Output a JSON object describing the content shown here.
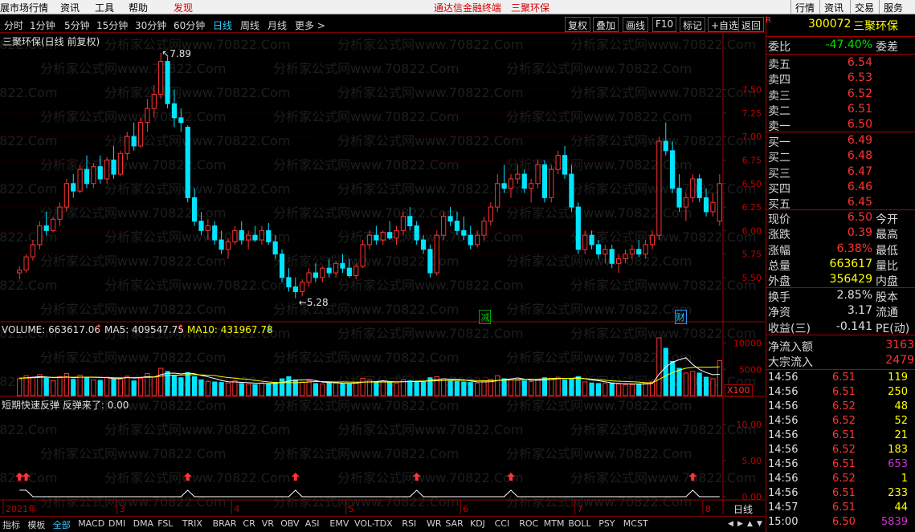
{
  "topbar": {
    "items": [
      "展市场行情",
      "资讯",
      "工具",
      "帮助"
    ],
    "highlight": "发现",
    "center_items": [
      "通达信金融终端",
      "三聚环保"
    ],
    "right_buttons": [
      "行情",
      "资讯",
      "交易",
      "服务"
    ]
  },
  "toolbar": {
    "periods": [
      "分时",
      "1分钟",
      "5分钟",
      "15分钟",
      "30分钟",
      "60分钟",
      "日线",
      "周线",
      "月线",
      "更多 >"
    ],
    "active_period": "日线",
    "buttons": [
      "复权",
      "叠加",
      "画线",
      "F10",
      "标记",
      "+自选",
      "返回"
    ]
  },
  "chart": {
    "title": "三聚环保(日线 前复权)",
    "high_label": "7.89",
    "low_label": "5.28",
    "price_axis": [
      "7.50",
      "7.25",
      "7.00",
      "6.75",
      "6.50",
      "6.25",
      "6.00",
      "5.75",
      "5.50"
    ],
    "badge_jian": "减",
    "badge_cai": "财",
    "volume_label": "VOLUME: 663617.06",
    "ma5_label": "MA5: 409547.75",
    "ma10_label": "MA10: 431967.78",
    "vol_axis": [
      "10000",
      "5000"
    ],
    "vol_unit": "X100",
    "indicator_label": "短期快速反弹 反弹来了: 0.00",
    "ind_axis": [
      "10.00",
      "5.00",
      "0.00"
    ],
    "date_labels": [
      "2021年",
      "3",
      "4",
      "5",
      "6",
      "7",
      "8"
    ],
    "period_name": "日线",
    "watermark": "分析家公式网www.70822.Com"
  },
  "panel": {
    "code": "300072",
    "name": "三聚环保",
    "weibi_label": "委比",
    "weibi_value": "-47.40%",
    "weicha_label": "委差",
    "asks": [
      {
        "label": "卖五",
        "price": "6.54"
      },
      {
        "label": "卖四",
        "price": "6.53"
      },
      {
        "label": "卖三",
        "price": "6.52"
      },
      {
        "label": "卖二",
        "price": "6.51"
      },
      {
        "label": "卖一",
        "price": "6.50"
      }
    ],
    "bids": [
      {
        "label": "买一",
        "price": "6.49"
      },
      {
        "label": "买二",
        "price": "6.48"
      },
      {
        "label": "买三",
        "price": "6.47"
      },
      {
        "label": "买四",
        "price": "6.46"
      },
      {
        "label": "买五",
        "price": "6.45"
      }
    ],
    "stats": [
      {
        "l": "现价",
        "v": "6.50",
        "r": "今开"
      },
      {
        "l": "涨跌",
        "v": "0.39",
        "r": "最高"
      },
      {
        "l": "涨幅",
        "v": "6.38%",
        "r": "最低"
      },
      {
        "l": "总量",
        "v": "663617",
        "r": "量比"
      },
      {
        "l": "外盘",
        "v": "356429",
        "r": "内盘"
      }
    ],
    "stats2": [
      {
        "l": "换手",
        "v": "2.85%",
        "r": "股本"
      },
      {
        "l": "净资",
        "v": "3.17",
        "r": "流通"
      },
      {
        "l": "收益(三)",
        "v": "-0.141",
        "r": "PE(动)"
      }
    ],
    "flow": [
      {
        "l": "净流入额",
        "v": "3163"
      },
      {
        "l": "大宗流入",
        "v": "2479"
      }
    ],
    "ticks": [
      {
        "t": "14:56",
        "p": "6.51",
        "v": "119",
        "c": "#ffff00"
      },
      {
        "t": "14:56",
        "p": "6.51",
        "v": "250",
        "c": "#ffff00"
      },
      {
        "t": "14:56",
        "p": "6.52",
        "v": "48",
        "c": "#ffff00"
      },
      {
        "t": "14:56",
        "p": "6.52",
        "v": "52",
        "c": "#ffff00"
      },
      {
        "t": "14:56",
        "p": "6.51",
        "v": "21",
        "c": "#ffff00"
      },
      {
        "t": "14:56",
        "p": "6.52",
        "v": "183",
        "c": "#ffff00"
      },
      {
        "t": "14:56",
        "p": "6.51",
        "v": "653",
        "c": "#cc33cc"
      },
      {
        "t": "14:56",
        "p": "6.52",
        "v": "1",
        "c": "#ffff00"
      },
      {
        "t": "14:56",
        "p": "6.51",
        "v": "233",
        "c": "#ffff00"
      },
      {
        "t": "14:57",
        "p": "6.51",
        "v": "44",
        "c": "#ffff00"
      },
      {
        "t": "15:00",
        "p": "6.50",
        "v": "5839",
        "c": "#cc33cc"
      }
    ]
  },
  "bottom_tabs": [
    "指标",
    "模板",
    "全部",
    "MACD",
    "DMI",
    "DMA",
    "FSL",
    "TRIX",
    "BRAR",
    "CR",
    "VR",
    "OBV",
    "ASI",
    "EMV",
    "VOL-TDX",
    "RSI",
    "WR",
    "SAR",
    "KDJ",
    "CCI",
    "ROC",
    "MTM",
    "BOLL",
    "PSY",
    "MCST"
  ],
  "active_tab": "全部",
  "chart_data": {
    "type": "candlestick",
    "price_ylim": [
      5.2,
      7.95
    ],
    "candles": [
      [
        5.55,
        5.62,
        5.48,
        5.58
      ],
      [
        5.58,
        5.75,
        5.55,
        5.72
      ],
      [
        5.72,
        5.9,
        5.68,
        5.85
      ],
      [
        5.85,
        6.1,
        5.8,
        6.05
      ],
      [
        6.05,
        6.2,
        5.95,
        6.0
      ],
      [
        6.0,
        6.15,
        5.98,
        6.12
      ],
      [
        6.12,
        6.3,
        6.05,
        6.25
      ],
      [
        6.25,
        6.55,
        6.2,
        6.5
      ],
      [
        6.5,
        6.6,
        6.35,
        6.42
      ],
      [
        6.42,
        6.7,
        6.4,
        6.65
      ],
      [
        6.65,
        6.8,
        6.45,
        6.5
      ],
      [
        6.5,
        6.72,
        6.45,
        6.68
      ],
      [
        6.68,
        6.8,
        6.5,
        6.55
      ],
      [
        6.55,
        6.78,
        6.5,
        6.75
      ],
      [
        6.75,
        6.9,
        6.55,
        6.6
      ],
      [
        6.6,
        6.85,
        6.58,
        6.82
      ],
      [
        6.82,
        7.05,
        6.75,
        7.0
      ],
      [
        7.0,
        7.15,
        6.85,
        6.9
      ],
      [
        6.9,
        7.2,
        6.88,
        7.15
      ],
      [
        7.15,
        7.4,
        7.05,
        7.3
      ],
      [
        7.3,
        7.55,
        7.2,
        7.45
      ],
      [
        7.45,
        7.89,
        7.4,
        7.8
      ],
      [
        7.8,
        7.85,
        7.3,
        7.35
      ],
      [
        7.35,
        7.5,
        7.1,
        7.2
      ],
      [
        7.2,
        7.3,
        7.05,
        7.15
      ],
      [
        7.1,
        7.12,
        6.3,
        6.35
      ],
      [
        6.35,
        6.45,
        6.05,
        6.1
      ],
      [
        6.1,
        6.2,
        5.95,
        6.0
      ],
      [
        6.0,
        6.12,
        5.9,
        6.05
      ],
      [
        6.05,
        6.1,
        5.85,
        5.9
      ],
      [
        5.9,
        6.0,
        5.75,
        5.8
      ],
      [
        5.8,
        5.92,
        5.7,
        5.88
      ],
      [
        5.88,
        6.05,
        5.85,
        6.0
      ],
      [
        6.0,
        6.1,
        5.85,
        5.9
      ],
      [
        5.9,
        6.0,
        5.8,
        5.95
      ],
      [
        5.95,
        6.05,
        5.88,
        5.9
      ],
      [
        5.9,
        6.05,
        5.85,
        6.0
      ],
      [
        6.0,
        6.08,
        5.85,
        5.88
      ],
      [
        5.88,
        5.95,
        5.7,
        5.75
      ],
      [
        5.75,
        5.8,
        5.45,
        5.5
      ],
      [
        5.5,
        5.6,
        5.35,
        5.4
      ],
      [
        5.4,
        5.5,
        5.28,
        5.35
      ],
      [
        5.35,
        5.48,
        5.3,
        5.45
      ],
      [
        5.45,
        5.6,
        5.4,
        5.55
      ],
      [
        5.55,
        5.65,
        5.45,
        5.5
      ],
      [
        5.5,
        5.62,
        5.45,
        5.6
      ],
      [
        5.6,
        5.7,
        5.5,
        5.55
      ],
      [
        5.55,
        5.68,
        5.5,
        5.65
      ],
      [
        5.65,
        5.75,
        5.55,
        5.6
      ],
      [
        5.6,
        5.7,
        5.5,
        5.52
      ],
      [
        5.52,
        5.65,
        5.48,
        5.62
      ],
      [
        5.62,
        5.9,
        5.6,
        5.85
      ],
      [
        5.85,
        6.0,
        5.8,
        5.95
      ],
      [
        5.95,
        6.05,
        5.85,
        5.9
      ],
      [
        5.9,
        6.0,
        5.85,
        5.98
      ],
      [
        5.98,
        6.1,
        5.9,
        5.92
      ],
      [
        5.92,
        6.05,
        5.85,
        6.0
      ],
      [
        6.0,
        6.2,
        5.95,
        6.15
      ],
      [
        6.15,
        6.25,
        6.0,
        6.05
      ],
      [
        6.05,
        6.1,
        5.85,
        5.9
      ],
      [
        5.9,
        5.95,
        5.75,
        5.8
      ],
      [
        5.8,
        5.85,
        5.5,
        5.55
      ],
      [
        5.55,
        6.0,
        5.52,
        5.95
      ],
      [
        5.95,
        6.2,
        5.9,
        6.15
      ],
      [
        6.15,
        6.25,
        6.05,
        6.1
      ],
      [
        6.1,
        6.2,
        5.95,
        6.0
      ],
      [
        6.0,
        6.15,
        5.9,
        5.95
      ],
      [
        5.95,
        6.05,
        5.8,
        5.85
      ],
      [
        5.85,
        6.0,
        5.82,
        5.95
      ],
      [
        5.95,
        6.15,
        5.9,
        6.1
      ],
      [
        6.1,
        6.3,
        6.05,
        6.25
      ],
      [
        6.25,
        6.6,
        6.2,
        6.5
      ],
      [
        6.5,
        6.7,
        6.4,
        6.45
      ],
      [
        6.45,
        6.6,
        6.35,
        6.55
      ],
      [
        6.55,
        6.7,
        6.5,
        6.6
      ],
      [
        6.6,
        6.65,
        6.4,
        6.45
      ],
      [
        6.45,
        6.55,
        6.3,
        6.5
      ],
      [
        6.5,
        6.75,
        6.45,
        6.7
      ],
      [
        6.7,
        6.75,
        6.3,
        6.35
      ],
      [
        6.35,
        6.7,
        6.3,
        6.65
      ],
      [
        6.65,
        6.85,
        6.6,
        6.8
      ],
      [
        6.8,
        6.9,
        6.55,
        6.6
      ],
      [
        6.6,
        6.7,
        6.2,
        6.25
      ],
      [
        6.25,
        6.3,
        5.75,
        5.8
      ],
      [
        5.8,
        6.0,
        5.75,
        5.95
      ],
      [
        5.95,
        6.0,
        5.8,
        5.85
      ],
      [
        5.85,
        5.9,
        5.7,
        5.75
      ],
      [
        5.75,
        5.85,
        5.65,
        5.8
      ],
      [
        5.8,
        5.85,
        5.6,
        5.65
      ],
      [
        5.65,
        5.75,
        5.55,
        5.7
      ],
      [
        5.7,
        5.8,
        5.65,
        5.75
      ],
      [
        5.75,
        5.85,
        5.7,
        5.8
      ],
      [
        5.8,
        5.9,
        5.72,
        5.75
      ],
      [
        5.75,
        5.9,
        5.7,
        5.85
      ],
      [
        5.85,
        6.0,
        5.8,
        5.95
      ],
      [
        5.95,
        7.0,
        5.9,
        6.95
      ],
      [
        6.95,
        7.15,
        6.8,
        6.85
      ],
      [
        6.85,
        6.95,
        6.4,
        6.45
      ],
      [
        6.45,
        6.6,
        6.2,
        6.25
      ],
      [
        6.25,
        6.4,
        6.1,
        6.35
      ],
      [
        6.35,
        6.6,
        6.3,
        6.55
      ],
      [
        6.55,
        6.6,
        6.3,
        6.35
      ],
      [
        6.35,
        6.45,
        6.15,
        6.2
      ],
      [
        6.2,
        6.4,
        6.15,
        6.3
      ],
      [
        6.1,
        6.6,
        6.05,
        6.5
      ]
    ],
    "volumes": [
      3200,
      3800,
      3500,
      4000,
      3300,
      2800,
      3600,
      4200,
      3100,
      3900,
      3400,
      3000,
      2900,
      3500,
      3200,
      3100,
      3700,
      2800,
      3300,
      4200,
      3600,
      5200,
      4600,
      3800,
      3400,
      4400,
      3600,
      3000,
      2700,
      2600,
      2500,
      2400,
      2800,
      2300,
      2200,
      2100,
      2400,
      2300,
      2500,
      3200,
      3600,
      3000,
      2600,
      2800,
      2300,
      2200,
      2500,
      2400,
      2300,
      2200,
      2400,
      3300,
      2900,
      2600,
      2700,
      2500,
      2400,
      3000,
      2800,
      2700,
      2600,
      3400,
      3600,
      3200,
      2900,
      2700,
      2600,
      2500,
      2400,
      2800,
      3100,
      3800,
      3200,
      3000,
      2900,
      2800,
      2700,
      3100,
      3400,
      3300,
      3500,
      3000,
      3300,
      3600,
      2600,
      2400,
      2300,
      2300,
      2400,
      2200,
      2100,
      2100,
      2200,
      2400,
      2600,
      11000,
      9000,
      6500,
      5200,
      4300,
      4600,
      4300,
      3500,
      3200,
      6638
    ],
    "ma5": [
      3300,
      3400,
      3500,
      3600,
      3560,
      3440,
      3440,
      3580,
      3400,
      3520,
      3520,
      3520,
      3480,
      3420,
      3200,
      3240,
      3480,
      3340,
      3440,
      3620,
      3520,
      4000,
      4240,
      4280,
      4120,
      4280,
      4160,
      3840,
      3580,
      3240,
      2880,
      2640,
      2600,
      2520,
      2460,
      2360,
      2360,
      2300,
      2340,
      2500,
      2740,
      2920,
      2980,
      3040,
      2860,
      2580,
      2480,
      2440,
      2340,
      2320,
      2360,
      2560,
      2620,
      2680,
      2820,
      2680,
      2620,
      2640,
      2680,
      2680,
      2700,
      2900,
      3040,
      3180,
      3140,
      3080,
      3000,
      2780,
      2620,
      2600,
      2640,
      2840,
      3060,
      3180,
      3360,
      3140,
      2920,
      2900,
      3000,
      3060,
      3200,
      3260,
      3260,
      3420,
      3200,
      2980,
      2840,
      2640,
      2400,
      2320,
      2260,
      2220,
      2200,
      2200,
      2280,
      4060,
      5460,
      6340,
      6840,
      7200,
      5920,
      4980,
      4380,
      3980,
      4070
    ],
    "ma10": [
      3300,
      3350,
      3400,
      3450,
      3500,
      3480,
      3500,
      3500,
      3500,
      3520,
      3500,
      3480,
      3460,
      3440,
      3400,
      3380,
      3400,
      3420,
      3450,
      3480,
      3520,
      3700,
      3860,
      3880,
      3920,
      3980,
      4000,
      3940,
      3880,
      3820,
      3600,
      3440,
      3320,
      3180,
      3090,
      2910,
      2740,
      2590,
      2510,
      2470,
      2460,
      2470,
      2500,
      2590,
      2700,
      2680,
      2640,
      2600,
      2600,
      2580,
      2550,
      2570,
      2580,
      2580,
      2580,
      2580,
      2600,
      2660,
      2690,
      2750,
      2760,
      2780,
      2820,
      2870,
      2910,
      2930,
      2940,
      2920,
      2860,
      2840,
      2850,
      2880,
      2920,
      2970,
      3020,
      3080,
      3120,
      3140,
      3200,
      3270,
      3280,
      3280,
      3280,
      3290,
      3220,
      3130,
      3040,
      2920,
      2800,
      2740,
      2700,
      2630,
      2570,
      2470,
      2420,
      3080,
      3770,
      4380,
      4850,
      5220,
      5380,
      5430,
      5420,
      5420,
      5480
    ],
    "signals_at": [
      0,
      1,
      25,
      41,
      59,
      73,
      100
    ],
    "vol_ylim": [
      0,
      11000
    ],
    "ind_ylim": [
      0,
      12
    ]
  }
}
